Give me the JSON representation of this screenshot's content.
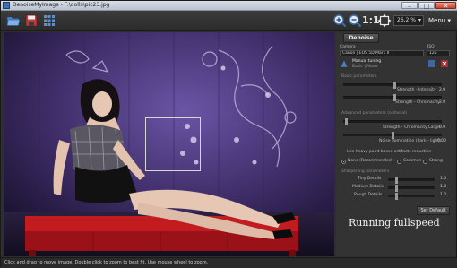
{
  "window": {
    "title": "DenoiseMyImage - F:\\dolls\\pic23.jpg",
    "minimize": "–",
    "maximize": "□",
    "close": "✕"
  },
  "toolbar": {
    "zoom_one_to_one": "1:1",
    "zoom_value": "26,2 %",
    "menu_label": "Menu ▾",
    "icons": [
      "folder-open-icon",
      "save-icon",
      "grid-icon",
      "zoom-in-icon",
      "zoom-out-icon",
      "fit-to-window-icon"
    ]
  },
  "panel": {
    "denoise_label": "Denoise",
    "camera_label": "Camera",
    "camera_value": "Canon | EOS 5D Mark II",
    "iso_label": "ISO:",
    "iso_value": "125",
    "manual_tuning": "Manual tuning",
    "manual_tuning_sub": "Basic | Mode",
    "basic_params_header": "Basic parameters",
    "strength_intensity_label": "Strength - Intensity",
    "strength_intensity_value": "2.0",
    "strength_chromacity_label": "Strength - Chromacity",
    "strength_chromacity_value": "2.0",
    "advanced_params_header": "Advanced parameters (optional)",
    "strength_chromacity_large_label": "Strength - Chromacity Large:",
    "strength_chromacity_large_value": "0.0",
    "noise_domination_label": "Noise domination (dark - light):",
    "noise_domination_value": "0.00",
    "heavy_point_label": "Use heavy point based artifacts reduction",
    "radio_none": "None (Recommended)",
    "radio_common": "Common",
    "radio_strong": "Strong",
    "sharpening_header": "Sharpening parameters",
    "tiny_details_label": "Tiny Details",
    "tiny_details_value": "1.0",
    "medium_details_label": "Medium Details",
    "medium_details_value": "1.0",
    "rough_details_label": "Rough Details",
    "rough_details_value": "1.0",
    "set_default_label": "Set Default",
    "running_label": "Running fullspeed"
  },
  "status": {
    "text": "Click and drag to move image. Double click to zoom to best fit. Use mouse wheel to zoom."
  },
  "colors": {
    "background": "#2f2f2f",
    "photo_wall": "#3a2a5c",
    "sofa": "#b3181d"
  }
}
